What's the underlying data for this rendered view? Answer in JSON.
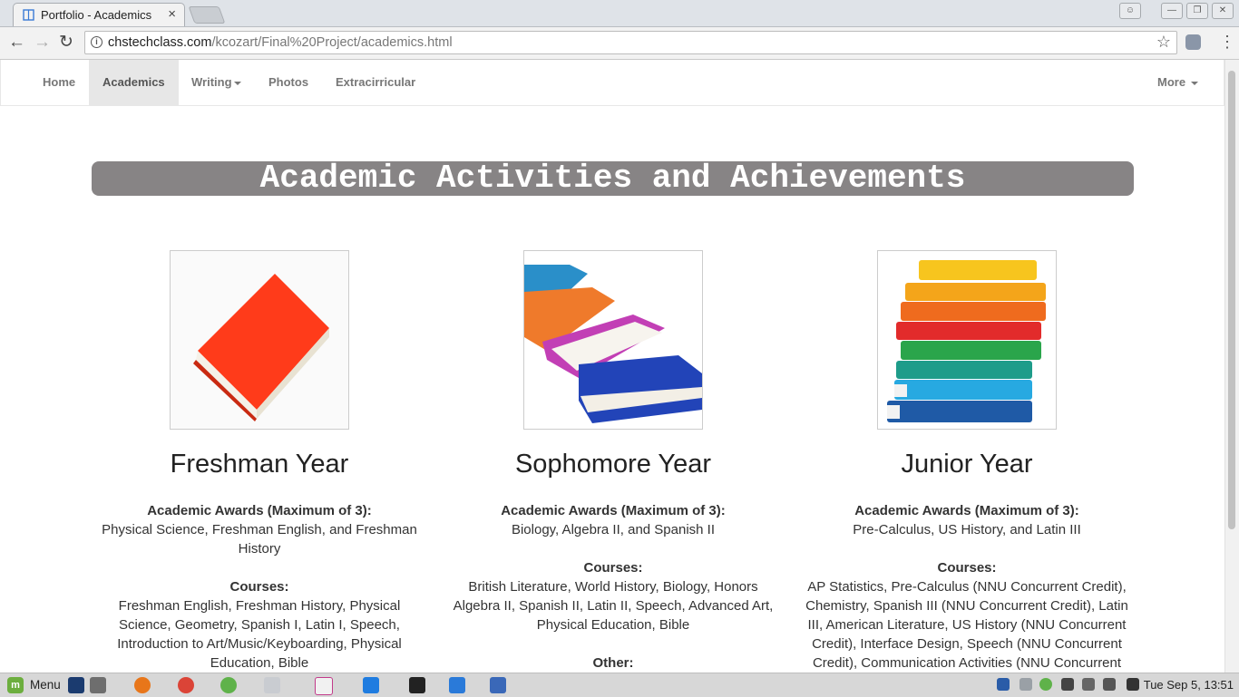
{
  "browser": {
    "tab_title": "Portfolio - Academics",
    "tab_close": "×",
    "url_domain": "chstechclass.com",
    "url_path": "/kcozart/Final%20Project/academics.html",
    "window_buttons": [
      "—",
      "❐",
      "✕"
    ]
  },
  "nav": {
    "items": [
      {
        "label": "Home"
      },
      {
        "label": "Academics",
        "active": true
      },
      {
        "label": "Writing",
        "dropdown": true
      },
      {
        "label": "Photos"
      },
      {
        "label": "Extracirricular"
      }
    ],
    "more_label": "More"
  },
  "page": {
    "title": "Academic Activities and Achievements",
    "years": [
      {
        "heading": "Freshman Year",
        "image": "red-book",
        "awards_label": "Academic Awards (Maximum of 3):",
        "awards": "Physical Science, Freshman English, and Freshman History",
        "courses_label": "Courses:",
        "courses": "Freshman English, Freshman History, Physical Science, Geometry, Spanish I, Latin I, Speech, Introduction to Art/Music/Keyboarding, Physical Education, Bible"
      },
      {
        "heading": "Sophomore Year",
        "image": "scattered-books",
        "awards_label": "Academic Awards (Maximum of 3):",
        "awards": "Biology, Algebra II, and Spanish II",
        "courses_label": "Courses:",
        "courses": "British Literature, World History, Biology, Honors Algebra II, Spanish II, Latin II, Speech, Advanced Art, Physical Education, Bible",
        "other_label": "Other:"
      },
      {
        "heading": "Junior Year",
        "image": "stack-of-books",
        "awards_label": "Academic Awards (Maximum of 3):",
        "awards": "Pre-Calculus, US History, and Latin III",
        "courses_label": "Courses:",
        "courses": "AP Statistics, Pre-Calculus (NNU Concurrent Credit), Chemistry, Spanish III (NNU Concurrent Credit), Latin III, American Literature, US History (NNU Concurrent Credit), Interface Design, Speech (NNU Concurrent Credit), Communication Activities (NNU Concurrent Credit)"
      }
    ]
  },
  "taskbar": {
    "menu_label": "Menu",
    "clock": "Tue Sep  5, 13:51"
  }
}
